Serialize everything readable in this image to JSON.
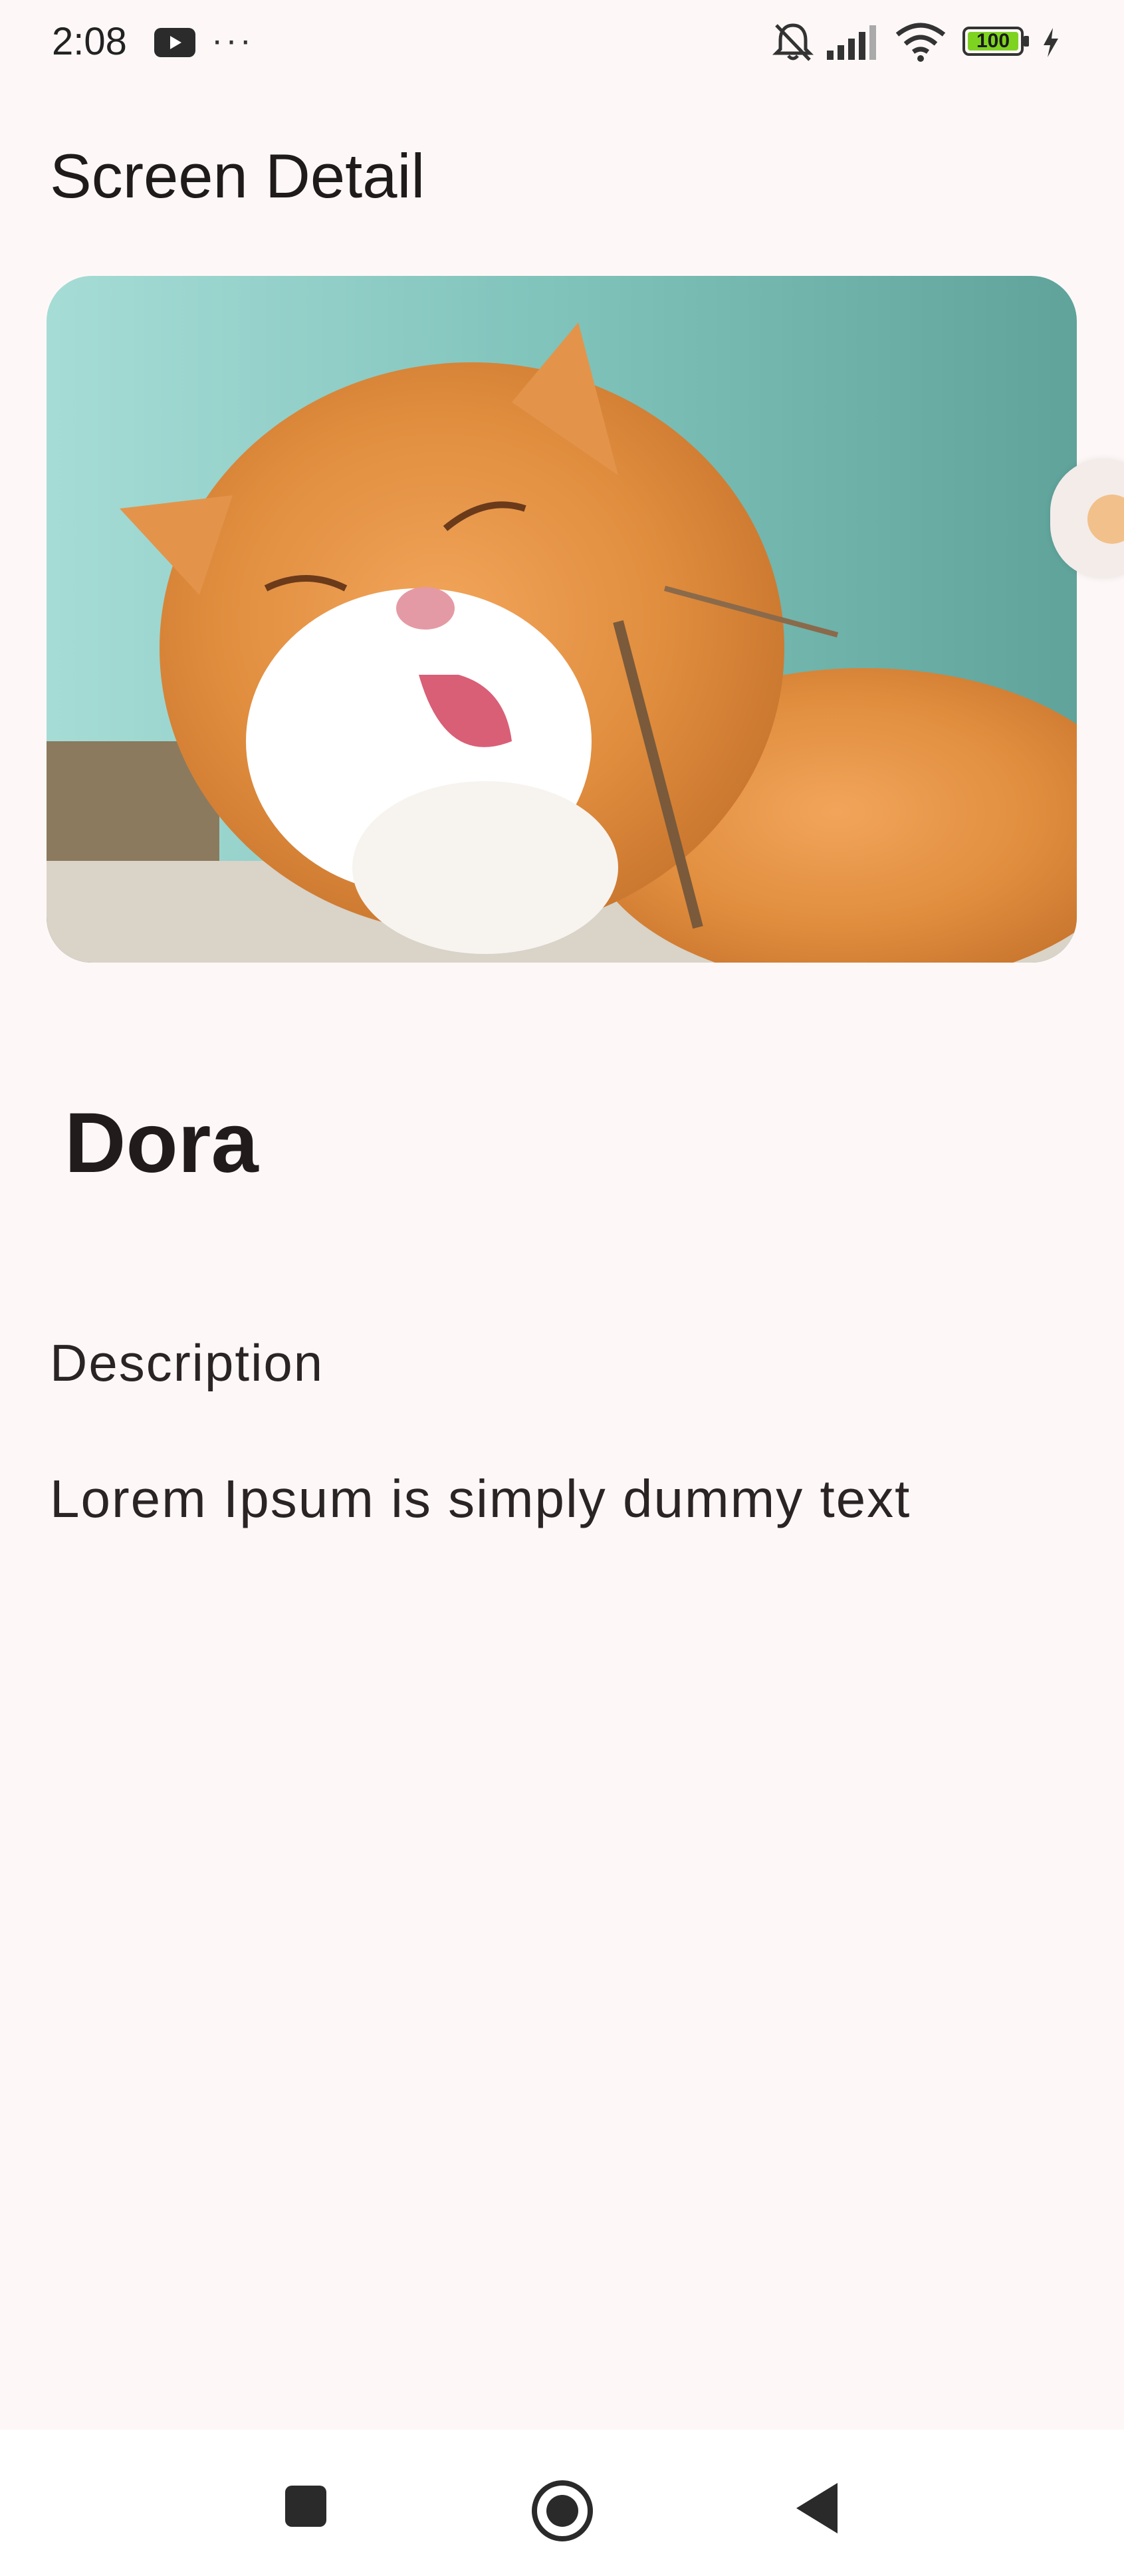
{
  "status_bar": {
    "time": "2:08",
    "overflow_dots": "···",
    "battery_level": "100",
    "icons": [
      "youtube-icon",
      "bell-muted-icon",
      "signal-icon",
      "wifi-icon",
      "battery-icon",
      "charging-bolt-icon"
    ]
  },
  "app_bar": {
    "title": "Screen Detail"
  },
  "detail": {
    "name": "Dora",
    "description_label": "Description",
    "description_text": "Lorem Ipsum is simply dummy text",
    "image_icon": "cat-photo"
  },
  "nav_bar": {
    "icons": [
      "recents-square-icon",
      "home-circle-icon",
      "back-triangle-icon"
    ]
  },
  "colors": {
    "background": "#fdf8f7",
    "text": "#1e1a1a",
    "battery_fill": "#7ed321"
  }
}
